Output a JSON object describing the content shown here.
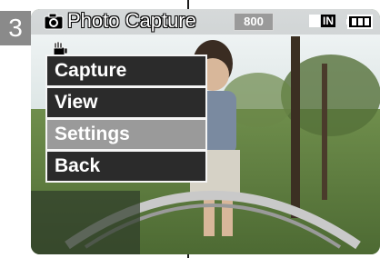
{
  "step": {
    "number": "3"
  },
  "header": {
    "mode_title": "Photo Capture",
    "resolution": "800",
    "memory": "IN",
    "icons": [
      "camera-icon",
      "stabilizer-icon",
      "memory-card-icon",
      "battery-icon"
    ]
  },
  "menu": {
    "items": [
      {
        "label": "Capture",
        "selected": false
      },
      {
        "label": "View",
        "selected": false
      },
      {
        "label": "Settings",
        "selected": true
      },
      {
        "label": "Back",
        "selected": false
      }
    ]
  },
  "colors": {
    "menu_item_bg": "#2b2b2b",
    "menu_item_selected_bg": "#9a9a9a",
    "badge_bg": "#8a8a8a"
  }
}
